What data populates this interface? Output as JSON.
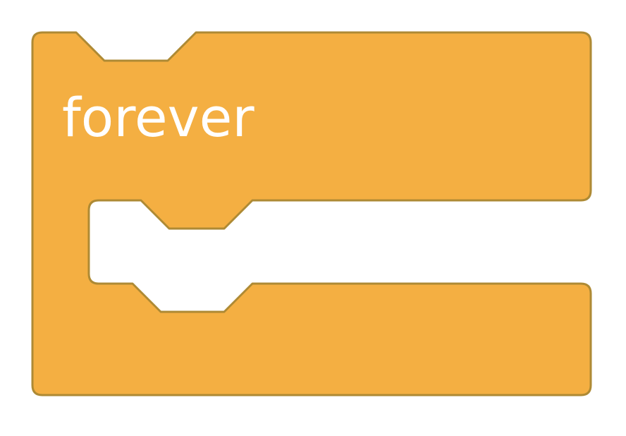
{
  "block": {
    "label": "forever",
    "kind": "c-block",
    "fill_color": "#F4AF42",
    "stroke_color": "#AE8A34",
    "text_color": "#FFFFFF"
  },
  "background_color": "#FFFFFF"
}
